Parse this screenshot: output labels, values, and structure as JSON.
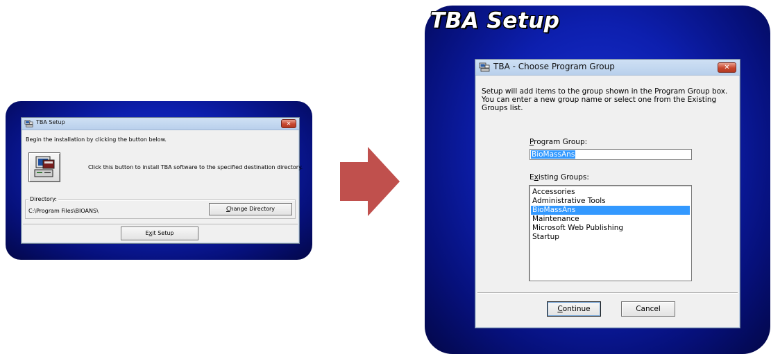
{
  "left": {
    "title": "TBA Setup",
    "close_label": "✕",
    "intro": "Begin the installation by clicking the button below.",
    "install_hint": "Click this button to install TBA software to the specified destination directory.",
    "directory_legend": "Directory:",
    "directory_path": "C:\\Program Files\\BIOANS\\",
    "change_dir": {
      "pre": "",
      "u": "C",
      "post": "hange Directory"
    },
    "exit_setup": {
      "pre": "E",
      "u": "x",
      "post": "it Setup"
    }
  },
  "right": {
    "banner_title": "TBA Setup",
    "title": "TBA - Choose Program Group",
    "close_label": "✕",
    "description_lines": [
      "Setup will add items to the group shown in the Program Group box.",
      "You can enter a new group name or select one from the Existing",
      "Groups list."
    ],
    "program_group_label": {
      "pre": "",
      "u": "P",
      "post": "rogram Group:"
    },
    "program_group_value": "BioMassAns",
    "existing_groups_label": {
      "pre": "E",
      "u": "x",
      "post": "isting Groups:"
    },
    "existing_groups": [
      "Accessories",
      "Administrative Tools",
      "BioMassAns",
      "Maintenance",
      "Microsoft Web Publishing",
      "Startup"
    ],
    "selected_group": "BioMassAns",
    "continue": {
      "pre": "",
      "u": "C",
      "post": "ontinue"
    },
    "cancel": "Cancel"
  },
  "colors": {
    "panel_blue": "#0d1fae",
    "arrow": "#c0504d",
    "selection": "#3399ff"
  }
}
